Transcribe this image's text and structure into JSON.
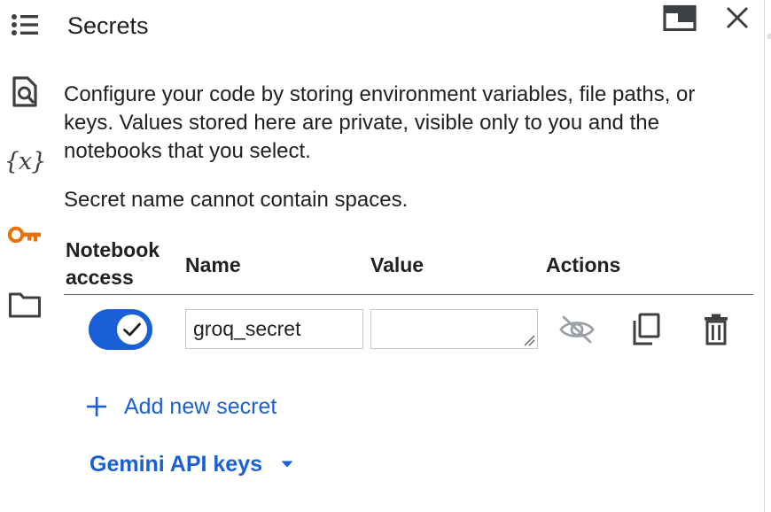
{
  "panel": {
    "title": "Secrets",
    "description": "Configure your code by storing environment variables, file paths, or keys. Values stored here are private, visible only to you and the notebooks that you select.",
    "note": "Secret name cannot contain spaces."
  },
  "sidebar": {
    "items": [
      {
        "icon": "table-of-contents-icon"
      },
      {
        "icon": "find-replace-icon"
      },
      {
        "icon": "variables-icon",
        "glyph": "{x}"
      },
      {
        "icon": "key-icon",
        "active": true
      },
      {
        "icon": "folder-icon"
      }
    ]
  },
  "header_buttons": {
    "dock": "dock-window-icon",
    "close": "close-icon"
  },
  "table": {
    "headers": {
      "access_line1": "Notebook",
      "access_line2": "access",
      "name": "Name",
      "value": "Value",
      "actions": "Actions"
    },
    "rows": [
      {
        "notebook_access": true,
        "name": "groq_secret",
        "value": "",
        "actions": [
          "visibility-off-icon",
          "copy-icon",
          "delete-icon"
        ]
      }
    ]
  },
  "buttons": {
    "add_secret": {
      "icon": "plus-icon",
      "label": "Add new secret"
    },
    "gemini_keys": {
      "label": "Gemini API keys",
      "icon": "caret-down-icon"
    }
  },
  "colors": {
    "accent": "#1a5fd6",
    "key_icon": "#e8710a",
    "text": "#202124",
    "icon_gray": "#5f6368"
  }
}
